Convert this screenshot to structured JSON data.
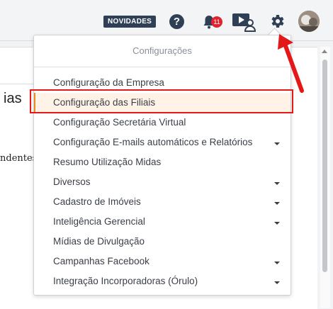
{
  "topbar": {
    "novidades_label": "NOVIDADES",
    "help_label": "?",
    "notifications_count": "11"
  },
  "background": {
    "text_ias": "ias",
    "text_ndentes": "ndentes"
  },
  "menu": {
    "header": "Configurações",
    "items": [
      {
        "label": "Configuração da Empresa",
        "submenu": false
      },
      {
        "label": "Configuração das Filiais",
        "submenu": false,
        "active": true
      },
      {
        "label": "Configuração Secretária Virtual",
        "submenu": false
      },
      {
        "label": "Configuração E-mails automáticos e Relatórios",
        "submenu": true
      },
      {
        "label": "Resumo Utilização Midas",
        "submenu": false
      },
      {
        "label": "Diversos",
        "submenu": true
      },
      {
        "label": "Cadastro de Imóveis",
        "submenu": true
      },
      {
        "label": "Inteligência Gerencial",
        "submenu": true
      },
      {
        "label": "Mídias de Divulgação",
        "submenu": false
      },
      {
        "label": "Campanhas Facebook",
        "submenu": true
      },
      {
        "label": "Integração Incorporadoras (Órulo)",
        "submenu": true
      }
    ]
  },
  "colors": {
    "accent_orange": "#f08a1c",
    "highlight_red": "#e31919",
    "badge_navy": "#2f3f55",
    "notification_red": "#e0242f"
  }
}
